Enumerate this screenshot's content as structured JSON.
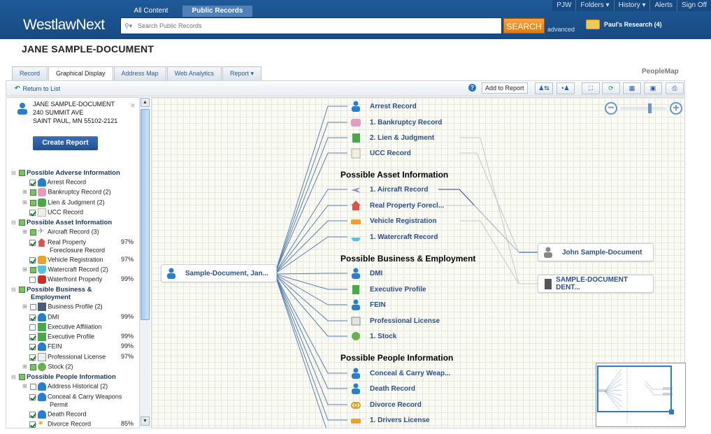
{
  "app": {
    "logo": "WestlawNext",
    "content_tabs": [
      "All Content",
      "Public Records"
    ],
    "selected_tab": "Public Records"
  },
  "topnav": {
    "user": "PJW",
    "folders": "Folders ▾",
    "history": "History ▾",
    "alerts": "Alerts",
    "signoff": "Sign Off"
  },
  "search": {
    "placeholder": "Search Public Records",
    "button": "SEARCH",
    "advanced": "advanced"
  },
  "research": {
    "label": "Paul's Research (4)"
  },
  "page": {
    "title": "JANE SAMPLE-DOCUMENT"
  },
  "tabs": [
    "Record",
    "Graphical Display",
    "Address Map",
    "Web Analytics",
    "Report ▾"
  ],
  "selected_view": "Graphical Display",
  "peoplemap": "PeopleMap",
  "toolbar": {
    "return": "Return to List",
    "add_report": "Add to Report",
    "help": "?"
  },
  "person": {
    "name": "JANE SAMPLE-DOCUMENT",
    "address1": "240 SUMMIT AVE",
    "address2": "SAINT PAUL, MN 55102-2121",
    "create_report": "Create Report"
  },
  "tree": {
    "adverse": {
      "title": "Possible Adverse Information",
      "items": [
        {
          "label": "Arrest Record",
          "pct": ""
        },
        {
          "label": "Bankruptcy Record (2)",
          "pct": ""
        },
        {
          "label": "Lien & Judgment (2)",
          "pct": ""
        },
        {
          "label": "UCC Record",
          "pct": ""
        }
      ]
    },
    "asset": {
      "title": "Possible Asset Information",
      "items": [
        {
          "label": "Aircraft Record (3)",
          "pct": ""
        },
        {
          "label": "Real Property",
          "label2": "Foreclosure Record",
          "pct": "97%"
        },
        {
          "label": "Vehicle Registration",
          "pct": "97%"
        },
        {
          "label": "Watercraft Record (2)",
          "pct": ""
        },
        {
          "label": "Waterfront Property",
          "pct": "99%"
        }
      ]
    },
    "business": {
      "title": "Possible Business &",
      "title2": "Employment",
      "items": [
        {
          "label": "Business Profile (2)",
          "pct": ""
        },
        {
          "label": "DMI",
          "pct": "99%"
        },
        {
          "label": "Executive Affiliation",
          "pct": ""
        },
        {
          "label": "Executive Profile",
          "pct": "99%"
        },
        {
          "label": "FEIN",
          "pct": "99%"
        },
        {
          "label": "Professional License",
          "pct": "97%"
        },
        {
          "label": "Stock (2)",
          "pct": ""
        }
      ]
    },
    "people": {
      "title": "Possible People Information",
      "items": [
        {
          "label": "Address Historical (2)",
          "pct": ""
        },
        {
          "label": "Conceal & Carry Weapons",
          "label2": "Permit",
          "pct": ""
        },
        {
          "label": "Death Record",
          "pct": ""
        },
        {
          "label": "Divorce Record",
          "pct": "85%"
        }
      ]
    }
  },
  "graph": {
    "root": "Sample-Document, Jan...",
    "sections": [
      "Possible Asset Information",
      "Possible Business & Employment",
      "Possible People Information"
    ],
    "adverse_nodes": [
      "Arrest Record",
      "1. Bankruptcy Record",
      "2. Lien & Judgment",
      "UCC Record"
    ],
    "asset_nodes": [
      "1. Aircraft Record",
      "Real Property Forecl...",
      "Vehicle Registration",
      "1. Watercraft Record"
    ],
    "business_nodes": [
      "DMI",
      "Executive Profile",
      "FEIN",
      "Professional License",
      "1. Stock"
    ],
    "people_nodes": [
      "Conceal & Carry Weap...",
      "Death Record",
      "Divorce Record",
      "1. Drivers License"
    ],
    "linked": [
      "John Sample-Document",
      "SAMPLE-DOCUMENT DENT..."
    ]
  }
}
